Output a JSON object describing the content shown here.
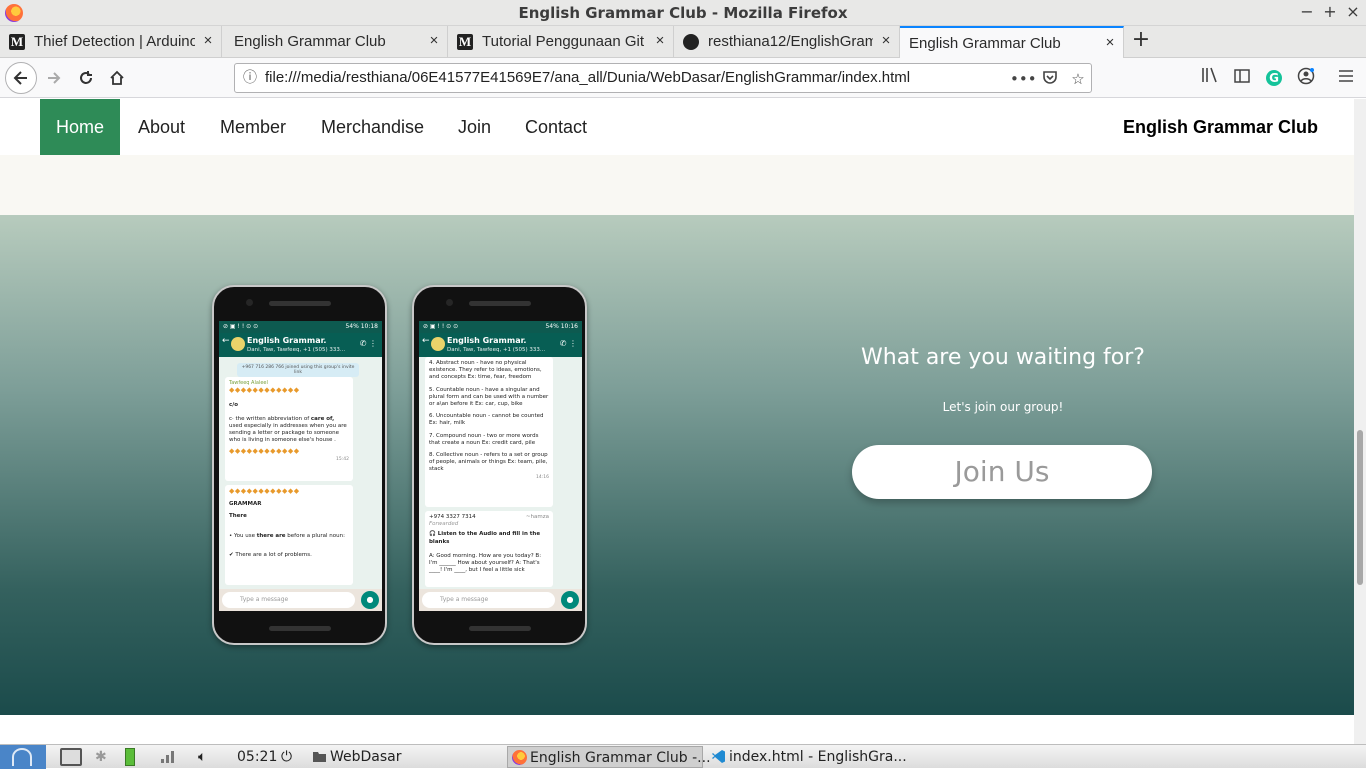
{
  "window": {
    "title": "English Grammar Club - Mozilla Firefox",
    "minimize": "−",
    "maximize": "+",
    "close": "×"
  },
  "tabs": [
    {
      "label": "Thief Detection | Arduino",
      "icon": "medium-icon"
    },
    {
      "label": "English Grammar Club",
      "icon": ""
    },
    {
      "label": "Tutorial Penggunaan Git",
      "icon": "medium-icon"
    },
    {
      "label": "resthiana12/EnglishGram",
      "icon": "github-icon"
    },
    {
      "label": "English Grammar Club",
      "icon": "",
      "active": true
    }
  ],
  "newtab_label": "+",
  "tab_close": "×",
  "toolbar": {
    "url": "file:///media/resthiana/06E41577E41569E7/ana_all/Dunia/WebDasar/EnglishGrammar/index.html",
    "more_label": "•••"
  },
  "site": {
    "nav": [
      "Home",
      "About",
      "Member",
      "Merchandise",
      "Join",
      "Contact"
    ],
    "active_nav": "Home",
    "brand": "English Grammar Club"
  },
  "promo": {
    "heading": "What are you waiting for?",
    "subheading": "Let's join our group!",
    "button": "Join Us"
  },
  "phones": {
    "group_name": "English Grammar.",
    "members": "Dani, Taw, Tawfeeq, +1 (505) 333...",
    "input_placeholder": "Type a message",
    "phone1": {
      "status_left": "⊘ ▣ ! ! ⊙ ⊙",
      "status_right": "54% 10:18",
      "system_msg": "+967 716 286 766 joined using this group's invite link",
      "sender": "Tawfeeq Alaleel",
      "diamonds": "◆◆◆◆◆◆◆◆◆◆◆◆",
      "term": "c/o",
      "definition_pre": "c· the written abbreviation of ",
      "definition_bold": "care of,",
      "definition_post": " used especially in addresses when you are sending a letter or package to someone who is living in someone else's house .",
      "time1": "15:42",
      "grammar_title": "GRAMMAR",
      "there": "There",
      "rule_pre": "• You use ",
      "rule_bold": "there are",
      "rule_post": " before a plural noun:",
      "example": "There are a lot of problems."
    },
    "phone2": {
      "status_right": "54% 10:16",
      "item4": "4. Abstract noun - have no physical existence. They refer to ideas, emotions, and concepts Ex: time, fear, freedom",
      "item5": "5. Countable noun - have a singular and plural form and can be used with a number or a\\an before it Ex: car, cup, bike",
      "item6": "6. Uncountable noun - cannot be counted Ex: hair, milk",
      "item7": "7. Compound noun - two or more words that create a noun Ex: credit card, pile",
      "item8": "8. Collective noun - refers to a set or group of people, animals or things Ex: team, pile, stack",
      "time2": "14:16",
      "sender2": "+974 3327 7314",
      "sender2_name": "~hamza",
      "forwarded": "Forwarded",
      "audio_title": "🎧 Listen to the Audio and fill in the blanks",
      "dialog": "A: Good morning. How are you today? B: I'm ______ How about yourself? A: That's ____! I'm ____, but I feel a little sick"
    }
  },
  "taskbar": {
    "time": "05:21",
    "folder": "WebDasar",
    "task_firefox": "English Grammar Club -...",
    "task_vscode": "index.html - EnglishGra..."
  }
}
